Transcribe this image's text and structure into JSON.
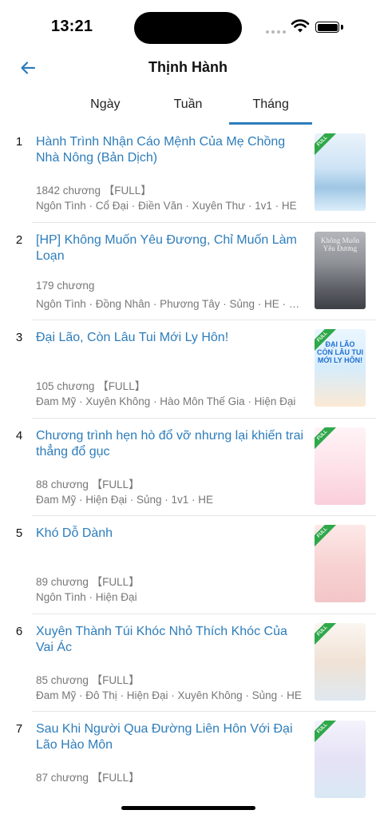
{
  "status_bar": {
    "time": "13:21"
  },
  "header": {
    "title": "Thịnh Hành",
    "back_icon": "arrow-left-icon"
  },
  "tabs": [
    {
      "label": "Ngày",
      "active": false
    },
    {
      "label": "Tuần",
      "active": false
    },
    {
      "label": "Tháng",
      "active": true
    }
  ],
  "colors": {
    "accent": "#2d7dbb",
    "meta_text": "#777777",
    "ribbon": "#2fa84a"
  },
  "stories": [
    {
      "rank": "1",
      "title": "Hành Trình Nhận Cáo Mệnh Của Mẹ Chồng Nhà Nông (Bản Dịch)",
      "meta": "1842 chương 【FULL】",
      "tags": "Ngôn Tình · Cổ Đại · Điền Văn · Xuyên Thư · 1v1 · HE",
      "full_badge": "FULL"
    },
    {
      "rank": "2",
      "title": "[HP] Không Muốn Yêu Đương, Chỉ Muốn Làm Loạn",
      "meta": "179 chương",
      "tags": "Ngôn Tình · Đồng Nhân · Phương Tây · Sủng · HE · Hài Hước",
      "cover_text": "Không Muốn Yêu Đương"
    },
    {
      "rank": "3",
      "title": "Đại Lão, Còn Lâu Tui Mới Ly Hôn!",
      "meta": "105 chương 【FULL】",
      "tags": "Đam Mỹ · Xuyên Không · Hào Môn Thế Gia · Hiện Đại",
      "full_badge": "FULL",
      "cover_text": "ĐẠI LÃO CÒN LÂU TUI MỚI LY HÔN!"
    },
    {
      "rank": "4",
      "title": "Chương trình hẹn hò đổ vỡ nhưng lại khiến trai thẳng đổ gục",
      "meta": "88 chương 【FULL】",
      "tags": "Đam Mỹ · Hiện Đại · Sủng · 1v1 · HE",
      "full_badge": "FULL"
    },
    {
      "rank": "5",
      "title": "Khó Dỗ Dành",
      "meta": "89 chương 【FULL】",
      "tags": "Ngôn Tình · Hiện Đại",
      "full_badge": "FULL"
    },
    {
      "rank": "6",
      "title": "Xuyên Thành Túi Khóc Nhỏ Thích Khóc Của Vai Ác",
      "meta": "85 chương 【FULL】",
      "tags": "Đam Mỹ · Đô Thị · Hiện Đại · Xuyên Không · Sủng · HE",
      "full_badge": "FULL"
    },
    {
      "rank": "7",
      "title": "Sau Khi Người Qua Đường Liên Hôn Với Đại Lão Hào Môn",
      "meta": "87 chương 【FULL】",
      "tags": "",
      "full_badge": "FULL"
    }
  ]
}
